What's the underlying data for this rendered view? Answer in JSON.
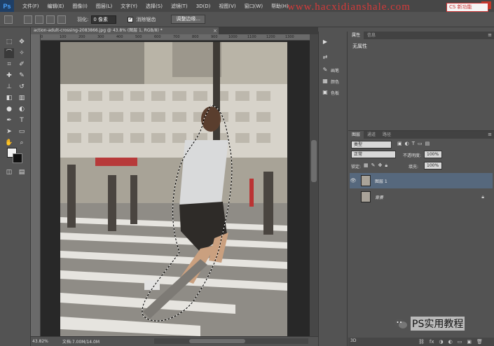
{
  "app": {
    "logo": "Ps",
    "menu": [
      "文件(F)",
      "编辑(E)",
      "图像(I)",
      "图层(L)",
      "文字(Y)",
      "选择(S)",
      "滤镜(T)",
      "3D(D)",
      "视图(V)",
      "窗口(W)",
      "帮助(H)"
    ],
    "watermark": "www.hacxidianshale.com",
    "window_controls": [
      "–",
      "□",
      "×"
    ]
  },
  "options": {
    "feather_label": "羽化:",
    "feather_value": "0 像素",
    "antialias_label": "消除锯齿",
    "refine_button": "调整边缘...",
    "workspace": "CS 新功能"
  },
  "document": {
    "tab_title": "action-adult-crossing-2083866.jpg @ 43.8% (图层 1, RGB/8) *",
    "close": "×",
    "ruler_ticks": [
      "0",
      "100",
      "200",
      "300",
      "400",
      "500",
      "600",
      "700",
      "800",
      "900",
      "1000",
      "1100",
      "1200",
      "1300"
    ],
    "zoom": "43.82%",
    "doc_info": "文档:7.00M/14.0M"
  },
  "dock": [
    {
      "icon": "play-icon",
      "glyph": "▶",
      "label": ""
    },
    {
      "icon": "adjust-icon",
      "glyph": "⇄",
      "label": ""
    },
    {
      "icon": "brush-preset-icon",
      "glyph": "✎",
      "label": "画笔"
    },
    {
      "icon": "swatch-icon",
      "glyph": "▦",
      "label": "颜色"
    },
    {
      "icon": "styles-icon",
      "glyph": "▣",
      "label": "色板"
    }
  ],
  "properties_panel": {
    "tabs": [
      "属性",
      "信息"
    ],
    "content": "无属性"
  },
  "layers_panel": {
    "tabs": [
      "图层",
      "通道",
      "路径"
    ],
    "filter_label": "类型",
    "blend_mode": "正常",
    "opacity_label": "不透明度:",
    "opacity_value": "100%",
    "lock_label": "锁定:",
    "fill_label": "填充:",
    "fill_value": "100%",
    "layers": [
      {
        "name": "图层 1",
        "visible": true,
        "selected": true,
        "locked": false
      },
      {
        "name": "背景",
        "visible": false,
        "selected": false,
        "locked": true
      }
    ],
    "footer_3d": "3D"
  },
  "brand": {
    "text": "PS实用教程"
  },
  "colors": {
    "accent_selected_layer": "#56687d",
    "panel_bg": "#535353",
    "menubar_bg": "#474747",
    "watermark": "#d43a3a"
  }
}
